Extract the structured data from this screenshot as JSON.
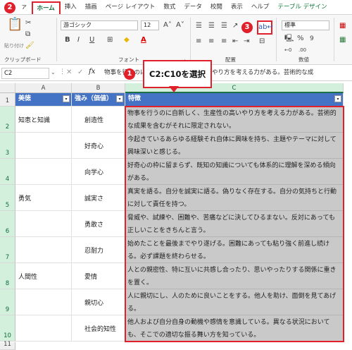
{
  "ribbon": {
    "tabs": [
      {
        "label": "ァ",
        "active": false
      },
      {
        "label": "ホーム",
        "active": true
      },
      {
        "label": "挿入",
        "active": false
      },
      {
        "label": "描画",
        "active": false
      },
      {
        "label": "ページ レイアウト",
        "active": false
      },
      {
        "label": "数式",
        "active": false
      },
      {
        "label": "データ",
        "active": false
      },
      {
        "label": "校閲",
        "active": false
      },
      {
        "label": "表示",
        "active": false
      },
      {
        "label": "ヘルプ",
        "active": false
      },
      {
        "label": "テーブル デザイン",
        "active": false
      }
    ],
    "groups": {
      "clipboard": "クリップボード",
      "paste": "貼り付け",
      "font": "フォント",
      "alignment": "配置",
      "number": "数値"
    },
    "font_name": "游ゴシック",
    "font_size": "12",
    "number_format": "標準",
    "wrap_icon": "wrap-text-icon"
  },
  "formula_bar": {
    "name_box": "C2",
    "fx": "fx",
    "content": "物事を行うのに自新しく、生産性の高いやり方を考える力がある。芸術的な成"
  },
  "annotations": {
    "callout": "C2:C10を選択",
    "step1": "1",
    "step2": "2",
    "step3": "3"
  },
  "sheet": {
    "columns": [
      "A",
      "B",
      "C"
    ],
    "headers": [
      "美徳",
      "強み（価値）",
      "特徴"
    ],
    "rows": [
      {
        "num": "2",
        "a": "知恵と知識",
        "b": "創造性",
        "c": "物事を行うのに自新しく、生産性の高いやり方を考える力がある。芸術的な成果を含むがそれに限定されない。"
      },
      {
        "num": "3",
        "a": "",
        "b": "好奇心",
        "c": "今起きているあらゆる経験それ自体に興味を持ち、主題やテーマに対して興味深いと感じる。"
      },
      {
        "num": "4",
        "a": "",
        "b": "向学心",
        "c": "好奇心の枠に留まらず、既知の知識についても体系的に理解を深める傾向がある。"
      },
      {
        "num": "5",
        "a": "勇気",
        "b": "誠実さ",
        "c": "真実を語る。自分を誠実に語る。偽りなく存在する。自分の気持ちと行動に対して責任を持つ。"
      },
      {
        "num": "6",
        "a": "",
        "b": "勇敢さ",
        "c": "脅威や、試練や、困難や、苦痛などに決してひるまない。反対にあっても正しいことをきちんと言う。"
      },
      {
        "num": "7",
        "a": "",
        "b": "忍耐力",
        "c": "始めたことを最後までやり遂げる。困難にあっても粘り強く前進し続ける。必ず課題を終わらせる。"
      },
      {
        "num": "8",
        "a": "人間性",
        "b": "愛情",
        "c": "人との親密性、特に互いに共感し合ったり、思いやったりする関係に重きを置く。"
      },
      {
        "num": "9",
        "a": "",
        "b": "親切心",
        "c": "人に親切にし、人のために良いことをする。他人を助け、面倒を見てあげる。"
      },
      {
        "num": "10",
        "a": "",
        "b": "社会的知性",
        "c": "他人および自分自身の動機や感情を意識している。異なる状況においても、そこでの適切な振る舞い方を知っている。"
      }
    ],
    "last_row": "11",
    "row1": "1"
  }
}
